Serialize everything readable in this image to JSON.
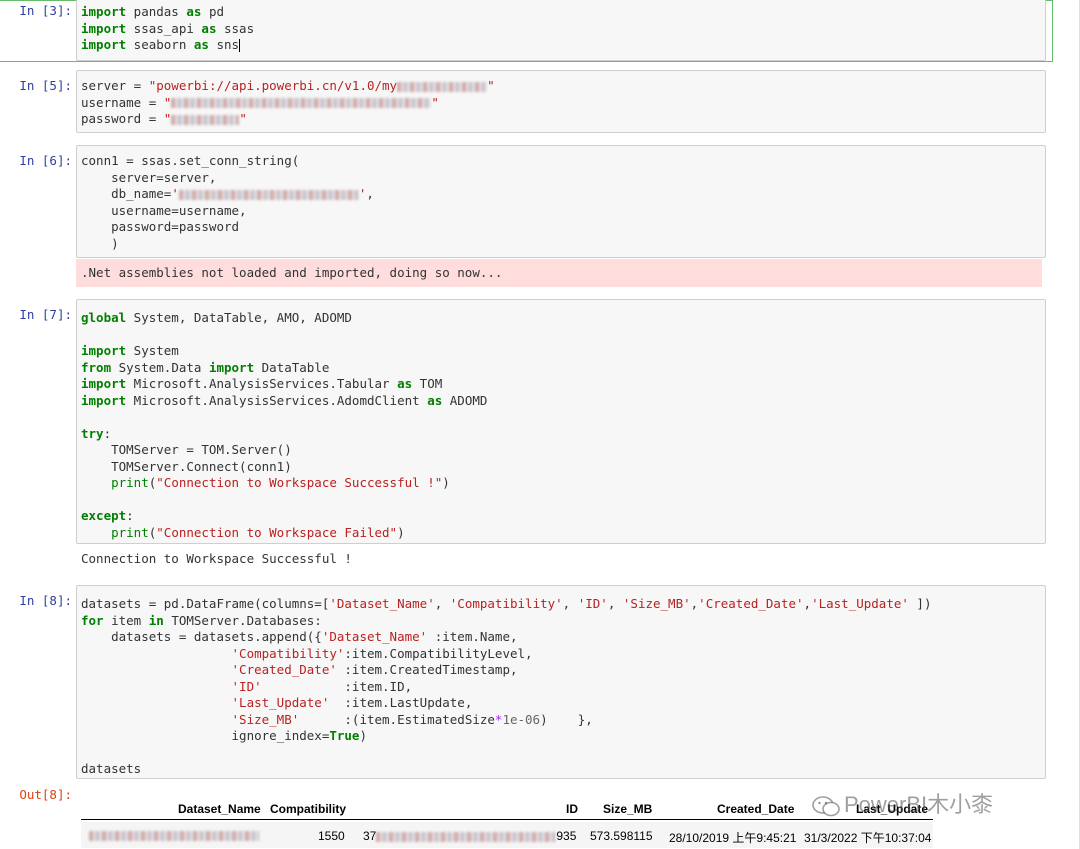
{
  "cells": {
    "c3": {
      "prompt": "In  [3]:",
      "lines": [
        {
          "kw": "import",
          "rest": " pandas ",
          "kw2": "as",
          "rest2": " pd"
        },
        {
          "kw": "import",
          "rest": " ssas_api ",
          "kw2": "as",
          "rest2": " ssas"
        },
        {
          "kw": "import",
          "rest": " seaborn ",
          "kw2": "as",
          "rest2": " sns"
        }
      ]
    },
    "c5": {
      "prompt": "In  [5]:",
      "server_prefix": "server = ",
      "server_value": "\"powerbi://api.powerbi.cn/v1.0/my",
      "username_prefix": "username = ",
      "password_prefix": "password = "
    },
    "c6": {
      "prompt": "In  [6]:",
      "l1": "conn1 = ssas.set_conn_string(",
      "l2": "    server=server,",
      "l3a": "    db_name=",
      "l4": "    username=username,",
      "l5": "    password=password",
      "l6": "    )",
      "stderr": ".Net assemblies not loaded and imported, doing so now..."
    },
    "c7": {
      "prompt": "In  [7]:",
      "l1_kw": "global",
      "l1_rest": " System, DataTable, AMO, ADOMD",
      "l3_kw": "import",
      "l3_rest": " System",
      "l4_kw": "from",
      "l4_mid": " System.Data ",
      "l4_kw2": "import",
      "l4_rest": " DataTable",
      "l5_kw": "import",
      "l5_mid": " Microsoft.AnalysisServices.Tabular ",
      "l5_kw2": "as",
      "l5_rest": " TOM",
      "l6_kw": "import",
      "l6_mid": " Microsoft.AnalysisServices.AdomdClient ",
      "l6_kw2": "as",
      "l6_rest": " ADOMD",
      "l8_kw": "try",
      "l9": "    TOMServer = TOM.Server()",
      "l10": "    TOMServer.Connect(conn1)",
      "l11_fn": "    print",
      "l11_str": "\"Connection to Workspace Successful !\"",
      "l13_kw": "except",
      "l14_fn": "    print",
      "l14_str": "\"Connection to Workspace Failed\"",
      "stdout": "Connection to Workspace Successful !"
    },
    "c8": {
      "prompt": "In  [8]:",
      "out_prompt": "Out[8]:",
      "l1a": "datasets = pd.DataFrame(columns=[",
      "col1": "'Dataset_Name'",
      "col2": "'Compatibility'",
      "col3": "'ID'",
      "col4": "'Size_MB'",
      "col5": "'Created_Date'",
      "col6": "'Last_Update'",
      "l2_kw": "for",
      "l2_mid": " item ",
      "l2_kw2": "in",
      "l2_rest": " TOMServer.Databases:",
      "l3a": "    datasets = datasets.append({",
      "l3_key": "'Dataset_Name'",
      "l3_val": " :item.Name,",
      "l4_key": "'Compatibility'",
      "l4_val": ":item.CompatibilityLevel,",
      "l5_key": "'Created_Date'",
      "l5_val": " :item.CreatedTimestamp,",
      "l6_key": "'ID'",
      "l6_val": "           :item.ID,",
      "l7_key": "'Last_Update'",
      "l7_val": "  :item.LastUpdate,",
      "l8_key": "'Size_MB'",
      "l8_val": "      :(item.EstimatedSize",
      "l8_op": "*",
      "l8_num": "1e-06",
      "l8_end": ")    },",
      "l9a": "                    ignore_index=",
      "l9_kw": "True",
      "l9_end": ")",
      "l11": "datasets"
    }
  },
  "table": {
    "headers": [
      "Dataset_Name",
      "Compatibility",
      "ID",
      "Size_MB",
      "Created_Date",
      "Last_Update"
    ],
    "row": {
      "compatibility": "1550",
      "id_prefix": "37",
      "id_suffix": "935",
      "size_mb": "573.598115",
      "created_date": "28/10/2019 上午9:45:21",
      "last_update": "31/3/2022 下午10:37:04"
    }
  },
  "watermark": "PowerBI木小桼"
}
